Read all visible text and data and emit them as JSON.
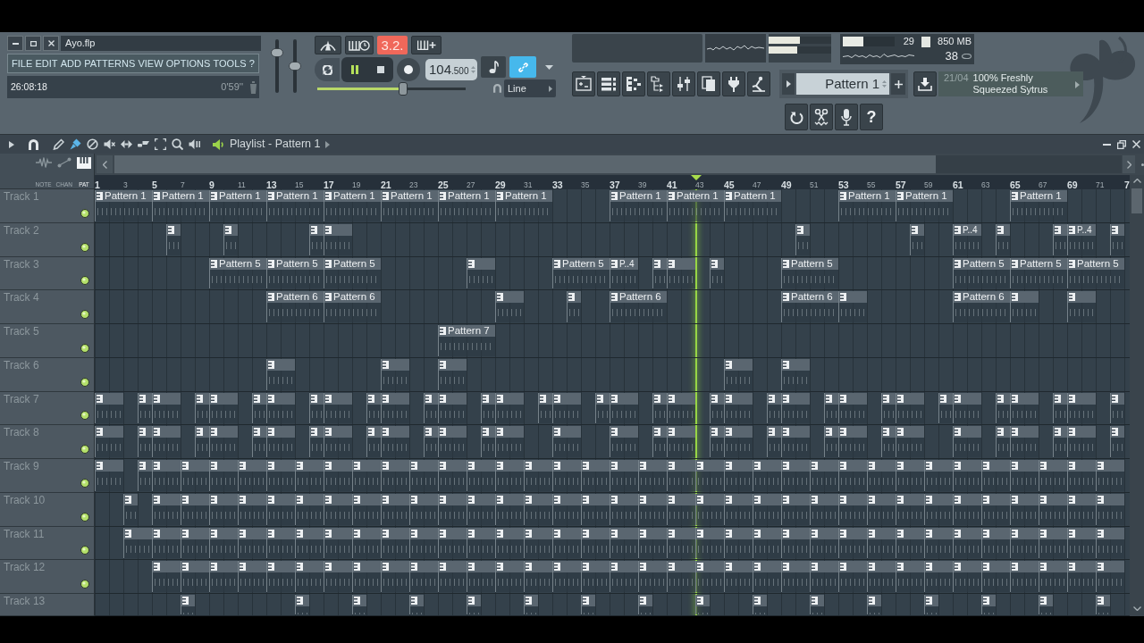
{
  "window": {
    "title": "Ayo.flp"
  },
  "menu": [
    "FILE",
    "EDIT",
    "ADD",
    "PATTERNS",
    "VIEW",
    "OPTIONS",
    "TOOLS",
    "?"
  ],
  "hint_bar": {
    "time": "26:08:18",
    "duration": "0'59''"
  },
  "master": {
    "volume": {
      "level": 0.8
    },
    "pitch": {
      "level": 0.5
    }
  },
  "transport": {
    "counter": "3.2.",
    "playing": true,
    "tempo": "104",
    "tempo_fraction": ".500",
    "position": {
      "level": 0.58
    },
    "link_on": true,
    "snap": "Line"
  },
  "meters": [
    {
      "level": 0.5
    },
    {
      "level": 0.46
    }
  ],
  "monitor": {
    "cpu": {
      "level": 0.4
    },
    "cpu_reading": "29",
    "memory": "850 MB",
    "polyphony": "38"
  },
  "pattern_selector": {
    "value": "Pattern 1"
  },
  "news": {
    "date": "21/04",
    "headline": "100% Freshly Squeezed Sytrus"
  },
  "help_button": "?",
  "playlist": {
    "title": "Playlist - Pattern 1",
    "tools": [
      {
        "selected": false
      },
      {
        "selected": true
      },
      {
        "selected": false
      },
      {
        "selected": false
      },
      {
        "selected": false
      },
      {
        "selected": false
      },
      {
        "selected": false
      },
      {
        "selected": false
      },
      {
        "selected": false
      }
    ],
    "modes": [
      {
        "label": "NOTE",
        "selected": false
      },
      {
        "label": "CHAN",
        "selected": false
      },
      {
        "label": "PAT",
        "selected": true
      }
    ],
    "ruler": [
      "1",
      "3",
      "5",
      "7",
      "9",
      "11",
      "13",
      "15",
      "17",
      "19",
      "21",
      "23",
      "25",
      "27",
      "29",
      "31",
      "33",
      "35",
      "37",
      "39",
      "41",
      "43",
      "45",
      "47",
      "49",
      "51",
      "53",
      "55",
      "57",
      "59",
      "61",
      "63",
      "65",
      "67",
      "69",
      "71",
      "7"
    ],
    "playhead": {
      "level": 0.581
    },
    "tracks": [
      {
        "name": "Track 1",
        "enabled": true,
        "slots": [
          {
            "kind": "quad",
            "label": "Pattern 1"
          },
          {
            "kind": "quad",
            "label": "Pattern 1"
          },
          {
            "kind": "quad",
            "label": "Pattern 1"
          },
          {
            "kind": "quad",
            "label": "Pattern 1"
          },
          {
            "kind": "quad",
            "label": "Pattern 1"
          },
          {
            "kind": "quad",
            "label": "Pattern 1"
          },
          {
            "kind": "quad",
            "label": "Pattern 1"
          },
          {
            "kind": "quad",
            "label": "Pattern 1"
          },
          {
            "kind": "empty"
          },
          {
            "kind": "empty"
          },
          {
            "kind": "empty"
          },
          {
            "kind": "empty"
          },
          {
            "kind": "quad",
            "label": "Pattern 1"
          },
          {
            "kind": "quad",
            "label": "Pattern 1"
          },
          {
            "kind": "quad",
            "label": "Pattern 1"
          },
          {
            "kind": "empty"
          },
          {
            "kind": "empty"
          },
          {
            "kind": "empty"
          },
          {
            "kind": "empty"
          },
          {
            "kind": "quad",
            "label": "Pattern 1"
          },
          {
            "kind": "quad",
            "label": "Pattern 1"
          },
          {
            "kind": "empty"
          },
          {
            "kind": "empty"
          },
          {
            "kind": "empty"
          },
          {
            "kind": "empty"
          },
          {
            "kind": "quad",
            "label": "Pattern 1"
          }
        ]
      },
      {
        "name": "Track 2",
        "enabled": true,
        "slots": [
          {
            "kind": "empty"
          },
          {
            "kind": "empty"
          },
          {
            "kind": "empty"
          },
          {
            "kind": "empty"
          },
          {
            "kind": "empty"
          },
          {
            "kind": "single"
          },
          {
            "kind": "empty"
          },
          {
            "kind": "empty"
          },
          {
            "kind": "empty"
          },
          {
            "kind": "single"
          },
          {
            "kind": "empty"
          },
          {
            "kind": "empty"
          },
          {
            "kind": "empty"
          },
          {
            "kind": "empty"
          },
          {
            "kind": "empty"
          },
          {
            "kind": "single"
          },
          {
            "kind": "double"
          },
          {
            "kind": "empty"
          },
          {
            "kind": "empty"
          },
          {
            "kind": "empty"
          },
          {
            "kind": "empty"
          },
          {
            "kind": "empty"
          },
          {
            "kind": "empty"
          },
          {
            "kind": "empty"
          },
          {
            "kind": "empty"
          },
          {
            "kind": "empty"
          },
          {
            "kind": "empty"
          },
          {
            "kind": "empty"
          },
          {
            "kind": "empty"
          },
          {
            "kind": "empty"
          },
          {
            "kind": "empty"
          },
          {
            "kind": "empty"
          },
          {
            "kind": "empty"
          },
          {
            "kind": "empty"
          },
          {
            "kind": "empty"
          },
          {
            "kind": "empty"
          },
          {
            "kind": "empty"
          },
          {
            "kind": "empty"
          },
          {
            "kind": "empty"
          },
          {
            "kind": "empty"
          },
          {
            "kind": "empty"
          },
          {
            "kind": "empty"
          },
          {
            "kind": "empty"
          },
          {
            "kind": "empty"
          },
          {
            "kind": "empty"
          },
          {
            "kind": "empty"
          },
          {
            "kind": "empty"
          },
          {
            "kind": "empty"
          },
          {
            "kind": "single"
          },
          {
            "kind": "empty"
          },
          {
            "kind": "empty"
          },
          {
            "kind": "empty"
          },
          {
            "kind": "empty"
          },
          {
            "kind": "empty"
          },
          {
            "kind": "empty"
          },
          {
            "kind": "empty"
          },
          {
            "kind": "single"
          },
          {
            "kind": "empty"
          },
          {
            "kind": "empty"
          },
          {
            "kind": "double",
            "label": "P..4"
          },
          {
            "kind": "empty"
          },
          {
            "kind": "single"
          },
          {
            "kind": "empty"
          },
          {
            "kind": "empty"
          },
          {
            "kind": "empty"
          },
          {
            "kind": "single"
          },
          {
            "kind": "double",
            "label": "P..4"
          },
          {
            "kind": "empty"
          },
          {
            "kind": "single"
          }
        ]
      },
      {
        "name": "Track 3",
        "enabled": true,
        "slots": [
          {
            "kind": "empty"
          },
          {
            "kind": "empty"
          },
          {
            "kind": "empty"
          },
          {
            "kind": "empty"
          },
          {
            "kind": "empty"
          },
          {
            "kind": "empty"
          },
          {
            "kind": "empty"
          },
          {
            "kind": "empty"
          },
          {
            "kind": "quad",
            "label": "Pattern 5"
          },
          {
            "kind": "quad",
            "label": "Pattern 5"
          },
          {
            "kind": "quad",
            "label": "Pattern 5"
          },
          {
            "kind": "empty"
          },
          {
            "kind": "empty"
          },
          {
            "kind": "empty"
          },
          {
            "kind": "empty"
          },
          {
            "kind": "empty"
          },
          {
            "kind": "empty"
          },
          {
            "kind": "double"
          },
          {
            "kind": "empty"
          },
          {
            "kind": "empty"
          },
          {
            "kind": "empty"
          },
          {
            "kind": "empty"
          },
          {
            "kind": "quad",
            "label": "Pattern 5"
          },
          {
            "kind": "double",
            "label": "P..4"
          },
          {
            "kind": "empty"
          },
          {
            "kind": "single"
          },
          {
            "kind": "double"
          },
          {
            "kind": "empty"
          },
          {
            "kind": "single"
          },
          {
            "kind": "empty"
          },
          {
            "kind": "empty"
          },
          {
            "kind": "empty"
          },
          {
            "kind": "empty"
          },
          {
            "kind": "quad",
            "label": "Pattern 5"
          },
          {
            "kind": "empty"
          },
          {
            "kind": "empty"
          },
          {
            "kind": "empty"
          },
          {
            "kind": "empty"
          },
          {
            "kind": "empty"
          },
          {
            "kind": "empty"
          },
          {
            "kind": "empty"
          },
          {
            "kind": "empty"
          },
          {
            "kind": "quad",
            "label": "Pattern 5"
          },
          {
            "kind": "quad",
            "label": "Pattern 5"
          },
          {
            "kind": "quad",
            "label": "Pattern 5"
          }
        ]
      },
      {
        "name": "Track 4",
        "enabled": true,
        "slots": [
          {
            "kind": "empty"
          },
          {
            "kind": "empty"
          },
          {
            "kind": "empty"
          },
          {
            "kind": "empty"
          },
          {
            "kind": "empty"
          },
          {
            "kind": "empty"
          },
          {
            "kind": "empty"
          },
          {
            "kind": "empty"
          },
          {
            "kind": "empty"
          },
          {
            "kind": "empty"
          },
          {
            "kind": "empty"
          },
          {
            "kind": "empty"
          },
          {
            "kind": "quad",
            "label": "Pattern 6"
          },
          {
            "kind": "quad",
            "label": "Pattern 6"
          },
          {
            "kind": "empty"
          },
          {
            "kind": "empty"
          },
          {
            "kind": "empty"
          },
          {
            "kind": "empty"
          },
          {
            "kind": "empty"
          },
          {
            "kind": "empty"
          },
          {
            "kind": "empty"
          },
          {
            "kind": "empty"
          },
          {
            "kind": "double"
          },
          {
            "kind": "empty"
          },
          {
            "kind": "empty"
          },
          {
            "kind": "empty"
          },
          {
            "kind": "single"
          },
          {
            "kind": "empty"
          },
          {
            "kind": "empty"
          },
          {
            "kind": "quad",
            "label": "Pattern 6"
          },
          {
            "kind": "empty"
          },
          {
            "kind": "empty"
          },
          {
            "kind": "empty"
          },
          {
            "kind": "empty"
          },
          {
            "kind": "empty"
          },
          {
            "kind": "empty"
          },
          {
            "kind": "empty"
          },
          {
            "kind": "empty"
          },
          {
            "kind": "quad",
            "label": "Pattern 6"
          },
          {
            "kind": "double"
          },
          {
            "kind": "empty"
          },
          {
            "kind": "empty"
          },
          {
            "kind": "empty"
          },
          {
            "kind": "empty"
          },
          {
            "kind": "empty"
          },
          {
            "kind": "empty"
          },
          {
            "kind": "quad",
            "label": "Pattern 6"
          },
          {
            "kind": "double"
          },
          {
            "kind": "empty"
          },
          {
            "kind": "empty"
          },
          {
            "kind": "double"
          }
        ]
      },
      {
        "name": "Track 5",
        "enabled": true,
        "slots": [
          {
            "kind": "empty"
          },
          {
            "kind": "empty"
          },
          {
            "kind": "empty"
          },
          {
            "kind": "empty"
          },
          {
            "kind": "empty"
          },
          {
            "kind": "empty"
          },
          {
            "kind": "empty"
          },
          {
            "kind": "empty"
          },
          {
            "kind": "empty"
          },
          {
            "kind": "empty"
          },
          {
            "kind": "empty"
          },
          {
            "kind": "empty"
          },
          {
            "kind": "empty"
          },
          {
            "kind": "empty"
          },
          {
            "kind": "empty"
          },
          {
            "kind": "empty"
          },
          {
            "kind": "empty"
          },
          {
            "kind": "empty"
          },
          {
            "kind": "empty"
          },
          {
            "kind": "empty"
          },
          {
            "kind": "empty"
          },
          {
            "kind": "empty"
          },
          {
            "kind": "empty"
          },
          {
            "kind": "empty"
          },
          {
            "kind": "quad",
            "label": "Pattern 7"
          }
        ]
      },
      {
        "name": "Track 6",
        "enabled": true,
        "slots": [
          {
            "kind": "empty"
          },
          {
            "kind": "empty"
          },
          {
            "kind": "empty"
          },
          {
            "kind": "empty"
          },
          {
            "kind": "empty"
          },
          {
            "kind": "empty"
          },
          {
            "kind": "empty"
          },
          {
            "kind": "empty"
          },
          {
            "kind": "empty"
          },
          {
            "kind": "empty"
          },
          {
            "kind": "empty"
          },
          {
            "kind": "empty"
          },
          {
            "kind": "double"
          },
          {
            "kind": "empty"
          },
          {
            "kind": "empty"
          },
          {
            "kind": "empty"
          },
          {
            "kind": "empty"
          },
          {
            "kind": "empty"
          },
          {
            "kind": "empty"
          },
          {
            "kind": "double"
          },
          {
            "kind": "empty"
          },
          {
            "kind": "empty"
          },
          {
            "kind": "double"
          },
          {
            "kind": "empty"
          },
          {
            "kind": "empty"
          },
          {
            "kind": "empty"
          },
          {
            "kind": "empty"
          },
          {
            "kind": "empty"
          },
          {
            "kind": "empty"
          },
          {
            "kind": "empty"
          },
          {
            "kind": "empty"
          },
          {
            "kind": "empty"
          },
          {
            "kind": "empty"
          },
          {
            "kind": "empty"
          },
          {
            "kind": "empty"
          },
          {
            "kind": "empty"
          },
          {
            "kind": "empty"
          },
          {
            "kind": "empty"
          },
          {
            "kind": "empty"
          },
          {
            "kind": "empty"
          },
          {
            "kind": "empty"
          },
          {
            "kind": "double"
          },
          {
            "kind": "empty"
          },
          {
            "kind": "empty"
          },
          {
            "kind": "double"
          }
        ]
      },
      {
        "name": "Track 7",
        "enabled": true,
        "slots": [
          {
            "kind": "double"
          },
          {
            "kind": "empty"
          },
          {
            "kind": "single"
          },
          {
            "kind": "double"
          },
          {
            "kind": "empty"
          },
          {
            "kind": "single"
          },
          {
            "kind": "double"
          },
          {
            "kind": "empty"
          },
          {
            "kind": "single"
          },
          {
            "kind": "double"
          },
          {
            "kind": "empty"
          },
          {
            "kind": "single"
          },
          {
            "kind": "double"
          },
          {
            "kind": "empty"
          },
          {
            "kind": "single"
          },
          {
            "kind": "double"
          },
          {
            "kind": "empty"
          },
          {
            "kind": "single"
          },
          {
            "kind": "double"
          },
          {
            "kind": "empty"
          },
          {
            "kind": "single"
          },
          {
            "kind": "double"
          },
          {
            "kind": "empty"
          },
          {
            "kind": "single"
          },
          {
            "kind": "double"
          },
          {
            "kind": "empty"
          },
          {
            "kind": "single"
          },
          {
            "kind": "double"
          },
          {
            "kind": "empty"
          },
          {
            "kind": "single"
          },
          {
            "kind": "double"
          },
          {
            "kind": "empty"
          },
          {
            "kind": "single"
          },
          {
            "kind": "double"
          },
          {
            "kind": "empty"
          },
          {
            "kind": "single"
          },
          {
            "kind": "double"
          },
          {
            "kind": "empty"
          },
          {
            "kind": "single"
          },
          {
            "kind": "double"
          },
          {
            "kind": "empty"
          },
          {
            "kind": "single"
          },
          {
            "kind": "double"
          },
          {
            "kind": "empty"
          },
          {
            "kind": "single"
          },
          {
            "kind": "double"
          },
          {
            "kind": "empty"
          },
          {
            "kind": "single"
          },
          {
            "kind": "double"
          },
          {
            "kind": "empty"
          },
          {
            "kind": "single"
          },
          {
            "kind": "double"
          },
          {
            "kind": "empty"
          },
          {
            "kind": "single"
          }
        ]
      },
      {
        "name": "Track 8",
        "enabled": true,
        "slots": [
          {
            "kind": "double"
          },
          {
            "kind": "empty"
          },
          {
            "kind": "single"
          },
          {
            "kind": "double"
          },
          {
            "kind": "empty"
          },
          {
            "kind": "single"
          },
          {
            "kind": "double"
          },
          {
            "kind": "empty"
          },
          {
            "kind": "single"
          },
          {
            "kind": "double"
          },
          {
            "kind": "empty"
          },
          {
            "kind": "single"
          },
          {
            "kind": "double"
          },
          {
            "kind": "empty"
          },
          {
            "kind": "single"
          },
          {
            "kind": "double"
          },
          {
            "kind": "empty"
          },
          {
            "kind": "single"
          },
          {
            "kind": "double"
          },
          {
            "kind": "empty"
          },
          {
            "kind": "single"
          },
          {
            "kind": "double"
          },
          {
            "kind": "empty"
          },
          {
            "kind": "empty"
          },
          {
            "kind": "double"
          },
          {
            "kind": "empty"
          },
          {
            "kind": "empty"
          },
          {
            "kind": "double"
          },
          {
            "kind": "empty"
          },
          {
            "kind": "single"
          },
          {
            "kind": "double"
          },
          {
            "kind": "empty"
          },
          {
            "kind": "single"
          },
          {
            "kind": "double"
          },
          {
            "kind": "empty"
          },
          {
            "kind": "single"
          },
          {
            "kind": "double"
          },
          {
            "kind": "empty"
          },
          {
            "kind": "single"
          },
          {
            "kind": "double"
          },
          {
            "kind": "empty"
          },
          {
            "kind": "single"
          },
          {
            "kind": "double"
          },
          {
            "kind": "empty"
          },
          {
            "kind": "empty"
          },
          {
            "kind": "double"
          },
          {
            "kind": "empty"
          },
          {
            "kind": "single"
          },
          {
            "kind": "double"
          },
          {
            "kind": "empty"
          },
          {
            "kind": "single"
          },
          {
            "kind": "double"
          },
          {
            "kind": "empty"
          },
          {
            "kind": "single"
          }
        ]
      },
      {
        "name": "Track 9",
        "enabled": true,
        "slots": [
          {
            "kind": "double"
          },
          {
            "kind": "empty"
          },
          {
            "kind": "single"
          },
          {
            "kind": "double"
          },
          {
            "kind": "double"
          },
          {
            "kind": "double"
          },
          {
            "kind": "double"
          },
          {
            "kind": "double"
          },
          {
            "kind": "double"
          },
          {
            "kind": "double"
          },
          {
            "kind": "double"
          },
          {
            "kind": "double"
          },
          {
            "kind": "double"
          },
          {
            "kind": "double"
          },
          {
            "kind": "double"
          },
          {
            "kind": "double"
          },
          {
            "kind": "double"
          },
          {
            "kind": "double"
          },
          {
            "kind": "double"
          },
          {
            "kind": "double"
          },
          {
            "kind": "double"
          },
          {
            "kind": "double"
          },
          {
            "kind": "double"
          },
          {
            "kind": "double"
          },
          {
            "kind": "double"
          },
          {
            "kind": "double"
          },
          {
            "kind": "double"
          },
          {
            "kind": "double"
          },
          {
            "kind": "double"
          },
          {
            "kind": "double"
          },
          {
            "kind": "double"
          },
          {
            "kind": "double"
          },
          {
            "kind": "double"
          },
          {
            "kind": "double"
          },
          {
            "kind": "double"
          },
          {
            "kind": "double"
          },
          {
            "kind": "double"
          }
        ]
      },
      {
        "name": "Track 10",
        "enabled": true,
        "slots": [
          {
            "kind": "empty"
          },
          {
            "kind": "empty"
          },
          {
            "kind": "single"
          },
          {
            "kind": "empty"
          },
          {
            "kind": "double"
          },
          {
            "kind": "double"
          },
          {
            "kind": "double"
          },
          {
            "kind": "double"
          },
          {
            "kind": "double"
          },
          {
            "kind": "double"
          },
          {
            "kind": "double"
          },
          {
            "kind": "double"
          },
          {
            "kind": "double"
          },
          {
            "kind": "double"
          },
          {
            "kind": "double"
          },
          {
            "kind": "double"
          },
          {
            "kind": "double"
          },
          {
            "kind": "double"
          },
          {
            "kind": "double"
          },
          {
            "kind": "double"
          },
          {
            "kind": "double"
          },
          {
            "kind": "double"
          },
          {
            "kind": "double"
          },
          {
            "kind": "double"
          },
          {
            "kind": "double"
          },
          {
            "kind": "double"
          },
          {
            "kind": "double"
          },
          {
            "kind": "double"
          },
          {
            "kind": "double"
          },
          {
            "kind": "double"
          },
          {
            "kind": "double"
          },
          {
            "kind": "double"
          },
          {
            "kind": "double"
          },
          {
            "kind": "double"
          },
          {
            "kind": "double"
          },
          {
            "kind": "double"
          },
          {
            "kind": "double"
          },
          {
            "kind": "double"
          }
        ]
      },
      {
        "name": "Track 11",
        "enabled": true,
        "slots": [
          {
            "kind": "empty"
          },
          {
            "kind": "empty"
          },
          {
            "kind": "double"
          },
          {
            "kind": "double"
          },
          {
            "kind": "double"
          },
          {
            "kind": "double"
          },
          {
            "kind": "double"
          },
          {
            "kind": "double"
          },
          {
            "kind": "double"
          },
          {
            "kind": "double"
          },
          {
            "kind": "double"
          },
          {
            "kind": "double"
          },
          {
            "kind": "double"
          },
          {
            "kind": "double"
          },
          {
            "kind": "double"
          },
          {
            "kind": "double"
          },
          {
            "kind": "double"
          },
          {
            "kind": "double"
          },
          {
            "kind": "double"
          },
          {
            "kind": "double"
          },
          {
            "kind": "double"
          },
          {
            "kind": "double"
          },
          {
            "kind": "double"
          },
          {
            "kind": "double"
          },
          {
            "kind": "double"
          },
          {
            "kind": "double"
          },
          {
            "kind": "double"
          },
          {
            "kind": "double"
          },
          {
            "kind": "double"
          },
          {
            "kind": "double"
          },
          {
            "kind": "double"
          },
          {
            "kind": "double"
          },
          {
            "kind": "double"
          },
          {
            "kind": "double"
          },
          {
            "kind": "double"
          },
          {
            "kind": "double"
          },
          {
            "kind": "double"
          }
        ]
      },
      {
        "name": "Track 12",
        "enabled": true,
        "slots": [
          {
            "kind": "empty"
          },
          {
            "kind": "empty"
          },
          {
            "kind": "empty"
          },
          {
            "kind": "empty"
          },
          {
            "kind": "double"
          },
          {
            "kind": "double"
          },
          {
            "kind": "double"
          },
          {
            "kind": "double"
          },
          {
            "kind": "double"
          },
          {
            "kind": "double"
          },
          {
            "kind": "double"
          },
          {
            "kind": "double"
          },
          {
            "kind": "double"
          },
          {
            "kind": "double"
          },
          {
            "kind": "double"
          },
          {
            "kind": "double"
          },
          {
            "kind": "double"
          },
          {
            "kind": "double"
          },
          {
            "kind": "double"
          },
          {
            "kind": "double"
          },
          {
            "kind": "double"
          },
          {
            "kind": "double"
          },
          {
            "kind": "double"
          },
          {
            "kind": "double"
          },
          {
            "kind": "double"
          },
          {
            "kind": "double"
          },
          {
            "kind": "double"
          },
          {
            "kind": "double"
          },
          {
            "kind": "double"
          },
          {
            "kind": "double"
          },
          {
            "kind": "double"
          },
          {
            "kind": "double"
          },
          {
            "kind": "double"
          },
          {
            "kind": "double"
          },
          {
            "kind": "double"
          },
          {
            "kind": "double"
          },
          {
            "kind": "double"
          },
          {
            "kind": "double"
          }
        ]
      },
      {
        "name": "Track 13",
        "slots": [
          {
            "kind": "empty"
          },
          {
            "kind": "empty"
          },
          {
            "kind": "empty"
          },
          {
            "kind": "empty"
          },
          {
            "kind": "empty"
          },
          {
            "kind": "empty"
          },
          {
            "kind": "single"
          },
          {
            "kind": "empty"
          },
          {
            "kind": "empty"
          },
          {
            "kind": "empty"
          },
          {
            "kind": "empty"
          },
          {
            "kind": "empty"
          },
          {
            "kind": "empty"
          },
          {
            "kind": "empty"
          },
          {
            "kind": "single"
          },
          {
            "kind": "empty"
          },
          {
            "kind": "empty"
          },
          {
            "kind": "empty"
          },
          {
            "kind": "single"
          },
          {
            "kind": "empty"
          },
          {
            "kind": "empty"
          },
          {
            "kind": "empty"
          },
          {
            "kind": "single"
          },
          {
            "kind": "empty"
          },
          {
            "kind": "empty"
          },
          {
            "kind": "empty"
          },
          {
            "kind": "single"
          },
          {
            "kind": "empty"
          },
          {
            "kind": "empty"
          },
          {
            "kind": "empty"
          },
          {
            "kind": "single"
          },
          {
            "kind": "empty"
          },
          {
            "kind": "empty"
          },
          {
            "kind": "empty"
          },
          {
            "kind": "single"
          },
          {
            "kind": "empty"
          },
          {
            "kind": "empty"
          },
          {
            "kind": "empty"
          },
          {
            "kind": "single"
          },
          {
            "kind": "empty"
          },
          {
            "kind": "empty"
          },
          {
            "kind": "empty"
          },
          {
            "kind": "single"
          },
          {
            "kind": "empty"
          },
          {
            "kind": "empty"
          },
          {
            "kind": "empty"
          },
          {
            "kind": "single"
          },
          {
            "kind": "empty"
          },
          {
            "kind": "empty"
          },
          {
            "kind": "empty"
          },
          {
            "kind": "single"
          },
          {
            "kind": "empty"
          },
          {
            "kind": "empty"
          },
          {
            "kind": "empty"
          },
          {
            "kind": "single"
          },
          {
            "kind": "empty"
          },
          {
            "kind": "empty"
          },
          {
            "kind": "empty"
          },
          {
            "kind": "single"
          },
          {
            "kind": "empty"
          },
          {
            "kind": "empty"
          },
          {
            "kind": "empty"
          },
          {
            "kind": "single"
          },
          {
            "kind": "empty"
          },
          {
            "kind": "empty"
          },
          {
            "kind": "empty"
          },
          {
            "kind": "single"
          },
          {
            "kind": "empty"
          },
          {
            "kind": "empty"
          },
          {
            "kind": "empty"
          },
          {
            "kind": "single"
          }
        ]
      }
    ]
  }
}
